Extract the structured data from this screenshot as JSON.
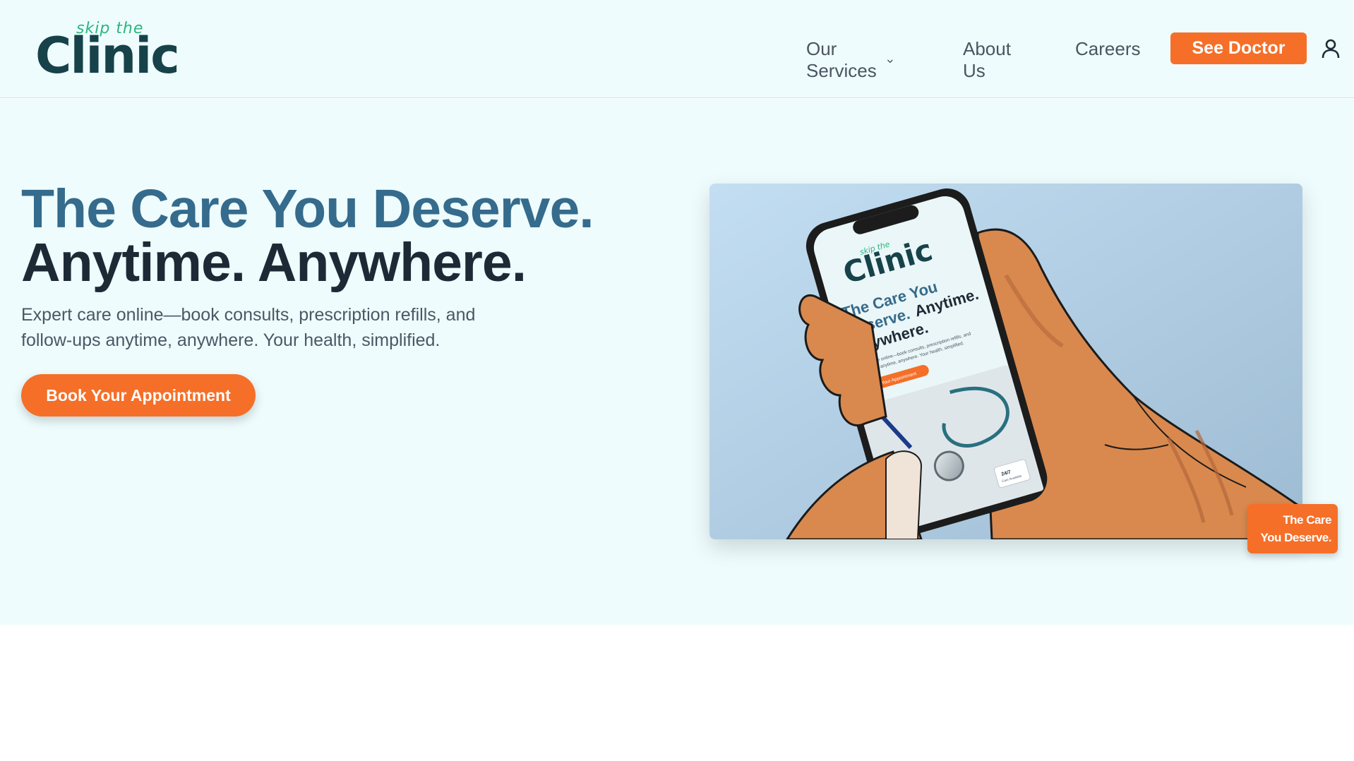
{
  "brand": {
    "skip": "skip the",
    "name": "Clinic"
  },
  "nav": {
    "services": "Our Services",
    "about": "About Us",
    "careers": "Careers",
    "cta": "See Doctor"
  },
  "hero": {
    "headline_line1": "The Care You Deserve.",
    "headline_line2": "Anytime. Anywhere.",
    "subtext": "Expert care online—book consults, prescription refills, and follow-ups anytime, anywhere. Your health, simplified.",
    "cta": "Book Your Appointment",
    "badge_line1": "The Care",
    "badge_line2": "You Deserve."
  },
  "phone_screen": {
    "skip": "skip the",
    "name": "Clinic",
    "headline_a": "The Care You",
    "headline_b": "Deserve.",
    "headline_c": "Anytime.",
    "headline_d": "Anywhere.",
    "sub_line1": "Expert care online—book consults, prescription refills, and",
    "sub_line2": "follow-ups anytime, anywhere. Your health, simplified.",
    "cta": "Book Your Appointment",
    "tag_line1": "24/7",
    "tag_line2": "Care Available"
  },
  "colors": {
    "accent": "#f56f28",
    "heading_blue": "#356b8c",
    "heading_dark": "#1d2a36",
    "brand_green": "#2bb57f",
    "brand_dark": "#17424a",
    "hero_bg": "#eefcfd"
  },
  "icons": {
    "chevron": "chevron-down-icon",
    "user": "user-icon"
  }
}
